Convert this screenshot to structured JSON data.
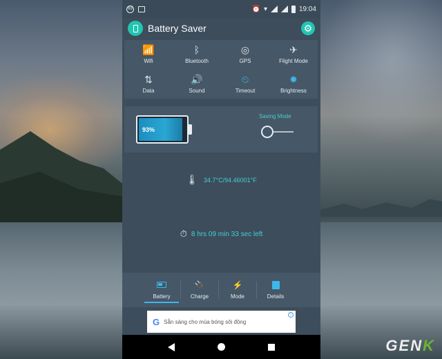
{
  "status_bar": {
    "time": "19:04",
    "left_icon_text": "69"
  },
  "app": {
    "title": "Battery Saver"
  },
  "toggles": [
    {
      "label": "Wifi",
      "icon": "wifi-icon",
      "glyph": "📶",
      "active": true
    },
    {
      "label": "Bluetooth",
      "icon": "bluetooth-icon",
      "glyph": "ᛒ",
      "active": false
    },
    {
      "label": "GPS",
      "icon": "gps-icon",
      "glyph": "◎",
      "active": false
    },
    {
      "label": "Flight Mode",
      "icon": "airplane-icon",
      "glyph": "✈",
      "active": false
    },
    {
      "label": "Data",
      "icon": "data-icon",
      "glyph": "⇅",
      "active": false
    },
    {
      "label": "Sound",
      "icon": "sound-icon",
      "glyph": "🔊",
      "active": true
    },
    {
      "label": "Timeout",
      "icon": "timeout-icon",
      "glyph": "⏲",
      "active": true
    },
    {
      "label": "Brightness",
      "icon": "brightness-icon",
      "glyph": "✹",
      "active": true
    }
  ],
  "battery": {
    "level_text": "93%",
    "level_fraction": 0.93
  },
  "saving_mode": {
    "label": "Saving Mode",
    "enabled": false
  },
  "temperature": {
    "text": "34.7°C/94.46001°F"
  },
  "time_left": {
    "text": "8 hrs 09 min  33 sec left"
  },
  "tabs": [
    {
      "label": "Battery",
      "icon": "battery-icon",
      "active": true
    },
    {
      "label": "Charge",
      "icon": "plug-icon",
      "active": false
    },
    {
      "label": "Mode",
      "icon": "bolt-icon",
      "active": false
    },
    {
      "label": "Details",
      "icon": "list-icon",
      "active": false
    }
  ],
  "ad": {
    "logo": "G",
    "text": "Sẵn sàng cho mùa bóng sôi động",
    "info": "i"
  },
  "watermark": {
    "part1": "GEN",
    "part2": "K"
  },
  "colors": {
    "accent_blue": "#3db8ea",
    "accent_teal": "#42d0d6",
    "panel": "#465767",
    "background": "#3d4d5b"
  }
}
